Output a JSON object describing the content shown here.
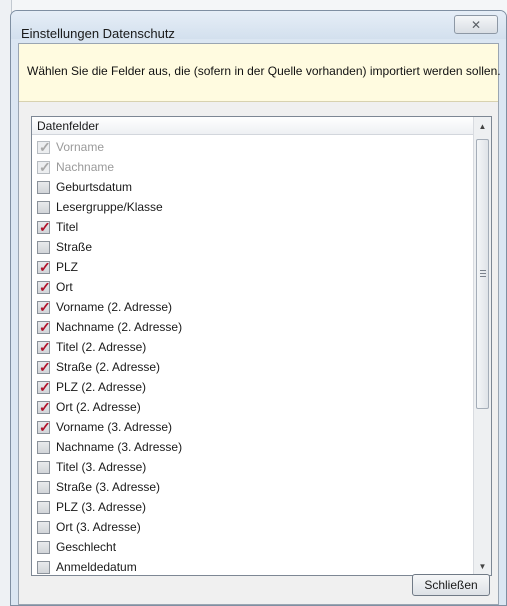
{
  "dialog": {
    "title": "Einstellungen Datenschutz",
    "close_icon_glyph": "✕"
  },
  "info": {
    "text": "Wählen Sie die Felder aus, die (sofern in der Quelle vorhanden) importiert werden sollen."
  },
  "list": {
    "header": "Datenfelder",
    "items": [
      {
        "label": "Vorname",
        "checked": true,
        "disabled": true
      },
      {
        "label": "Nachname",
        "checked": true,
        "disabled": true
      },
      {
        "label": "Geburtsdatum",
        "checked": false,
        "disabled": false
      },
      {
        "label": "Lesergruppe/Klasse",
        "checked": false,
        "disabled": false
      },
      {
        "label": "Titel",
        "checked": true,
        "disabled": false
      },
      {
        "label": "Straße",
        "checked": false,
        "disabled": false
      },
      {
        "label": "PLZ",
        "checked": true,
        "disabled": false
      },
      {
        "label": "Ort",
        "checked": true,
        "disabled": false
      },
      {
        "label": "Vorname (2. Adresse)",
        "checked": true,
        "disabled": false
      },
      {
        "label": "Nachname (2. Adresse)",
        "checked": true,
        "disabled": false
      },
      {
        "label": "Titel (2. Adresse)",
        "checked": true,
        "disabled": false
      },
      {
        "label": "Straße (2. Adresse)",
        "checked": true,
        "disabled": false
      },
      {
        "label": "PLZ (2. Adresse)",
        "checked": true,
        "disabled": false
      },
      {
        "label": "Ort (2. Adresse)",
        "checked": true,
        "disabled": false
      },
      {
        "label": "Vorname (3. Adresse)",
        "checked": true,
        "disabled": false
      },
      {
        "label": "Nachname (3. Adresse)",
        "checked": false,
        "disabled": false
      },
      {
        "label": "Titel (3. Adresse)",
        "checked": false,
        "disabled": false
      },
      {
        "label": "Straße (3. Adresse)",
        "checked": false,
        "disabled": false
      },
      {
        "label": "PLZ (3. Adresse)",
        "checked": false,
        "disabled": false
      },
      {
        "label": "Ort (3. Adresse)",
        "checked": false,
        "disabled": false
      },
      {
        "label": "Geschlecht",
        "checked": false,
        "disabled": false
      },
      {
        "label": "Anmeldedatum",
        "checked": false,
        "disabled": false
      }
    ]
  },
  "buttons": {
    "close_label": "Schließen"
  },
  "colors": {
    "info_background": "#fffbe0",
    "checkmark": "#b0122a",
    "title_background": "#dbe6f2"
  }
}
